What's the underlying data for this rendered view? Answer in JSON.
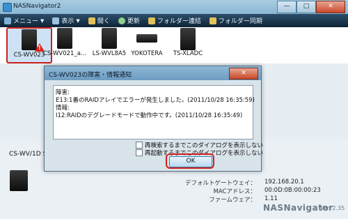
{
  "window": {
    "title": "NASNavigator2",
    "minimize": "—",
    "maximize": "□",
    "close": "✕"
  },
  "toolbar": {
    "items": [
      {
        "label": "メニュー"
      },
      {
        "label": "表示"
      },
      {
        "label": "開く"
      },
      {
        "label": "更新"
      },
      {
        "label": "フォルダー連結"
      },
      {
        "label": "フォルダー同期"
      }
    ]
  },
  "devices": [
    {
      "label": "CS-WV023"
    },
    {
      "label": "CS-WV021_a..."
    },
    {
      "label": "LS-WVL8A5"
    },
    {
      "label": "YOKOTERA"
    },
    {
      "label": "TS-XLADC"
    }
  ],
  "lower": {
    "device_name": "CS-WV/1D S",
    "info": [
      {
        "key": "デフォルトゲートウェイ：",
        "value": "192.168.20.1"
      },
      {
        "key": "MACアドレス：",
        "value": "00:0D:0B:00:00:23"
      },
      {
        "key": "ファームウェア：",
        "value": "1.11"
      }
    ],
    "brand": "NASNavigator",
    "version": "Ver. 2.35"
  },
  "dialog": {
    "title": "CS-WV023の障害・情報通知",
    "close": "✕",
    "messages": [
      "障害:",
      "E13:1番のRAIDアレイでエラーが発生しました。(2011/10/28 16:35:59)",
      "情報:",
      "I12:RAIDのデグレードモードで動作中です。(2011/10/28 16:35:49)"
    ],
    "checkboxes": [
      {
        "label": "再検索するまでこのダイアログを表示しない"
      },
      {
        "label": "再起動するまでこのダイアログを表示しない"
      }
    ],
    "ok_label": "OK"
  }
}
